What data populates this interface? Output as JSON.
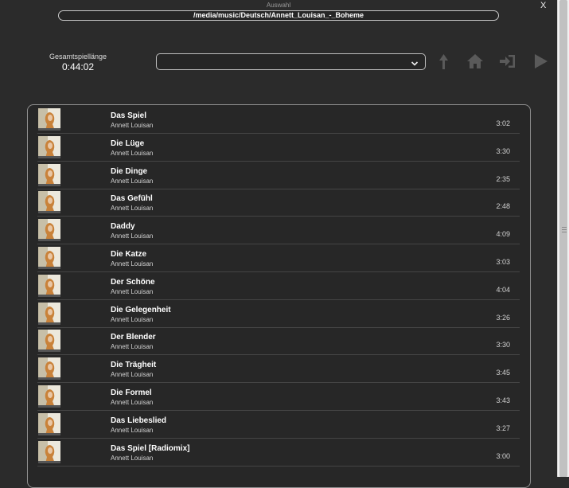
{
  "dialog": {
    "title": "Auswahl",
    "close_label": "X",
    "path": "/media/music/Deutsch/Annett_Louisan_-_Boheme"
  },
  "summary": {
    "total_label": "Gesamtspiellänge",
    "total_value": "0:44:02"
  },
  "select": {
    "value": ""
  },
  "toolbar": {
    "icons": [
      "upload-icon",
      "home-icon",
      "enter-icon",
      "play-icon"
    ],
    "icon_color": "#5a5a5a"
  },
  "colors": {
    "background": "#2b2b2b",
    "panel_border": "#8f8f8f",
    "text": "#ffffff"
  },
  "tracks": [
    {
      "title": "Das Spiel",
      "artist": "Annett Louisan",
      "duration": "3:02"
    },
    {
      "title": "Die Lüge",
      "artist": "Annett Louisan",
      "duration": "3:30"
    },
    {
      "title": "Die Dinge",
      "artist": "Annett Louisan",
      "duration": "2:35"
    },
    {
      "title": "Das Gefühl",
      "artist": "Annett Louisan",
      "duration": "2:48"
    },
    {
      "title": "Daddy",
      "artist": "Annett Louisan",
      "duration": "4:09"
    },
    {
      "title": "Die Katze",
      "artist": "Annett Louisan",
      "duration": "3:03"
    },
    {
      "title": "Der Schöne",
      "artist": "Annett Louisan",
      "duration": "4:04"
    },
    {
      "title": "Die Gelegenheit",
      "artist": "Annett Louisan",
      "duration": "3:26"
    },
    {
      "title": "Der Blender",
      "artist": "Annett Louisan",
      "duration": "3:30"
    },
    {
      "title": "Die Trägheit",
      "artist": "Annett Louisan",
      "duration": "3:45"
    },
    {
      "title": "Die Formel",
      "artist": "Annett Louisan",
      "duration": "3:43"
    },
    {
      "title": "Das Liebeslied",
      "artist": "Annett Louisan",
      "duration": "3:27"
    },
    {
      "title": "Das Spiel [Radiomix]",
      "artist": "Annett Louisan",
      "duration": "3:00"
    }
  ]
}
